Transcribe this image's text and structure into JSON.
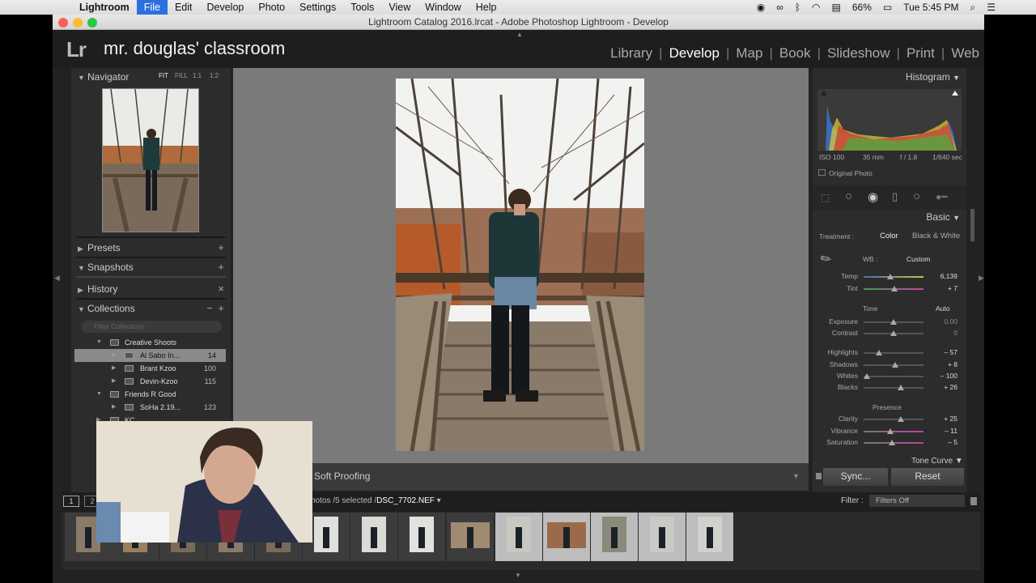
{
  "menubar": {
    "apple": "",
    "items": [
      "Lightroom",
      "File",
      "Edit",
      "Develop",
      "Photo",
      "Settings",
      "Tools",
      "View",
      "Window",
      "Help"
    ],
    "battery": "66%",
    "clock": "Tue 5:45 PM"
  },
  "window": {
    "title": "Lightroom Catalog 2016.lrcat - Adobe Photoshop Lightroom - Develop"
  },
  "app": {
    "logo": "Lr",
    "identity_plate": "mr. douglas' classroom",
    "modules": [
      "Library",
      "Develop",
      "Map",
      "Book",
      "Slideshow",
      "Print",
      "Web"
    ],
    "active_module": "Develop"
  },
  "navigator": {
    "title": "Navigator",
    "options": [
      "FIT",
      "FILL",
      "1:1",
      "1:2"
    ]
  },
  "left_panels": {
    "presets": "Presets",
    "snapshots": "Snapshots",
    "history": "History",
    "collections": "Collections",
    "filter_placeholder": "Filter Collections",
    "items": [
      {
        "label": "Creative Shoots",
        "count": ""
      },
      {
        "label": "Al Sabo In...",
        "count": "14"
      },
      {
        "label": "Brant Kzoo",
        "count": "100"
      },
      {
        "label": "Devin-Kzoo",
        "count": "115"
      },
      {
        "label": "Friends R Good",
        "count": ""
      },
      {
        "label": "SoHa 2.19...",
        "count": "123"
      },
      {
        "label": "KC",
        "count": ""
      }
    ]
  },
  "toolbar": {
    "soft_proofing": "Soft Proofing"
  },
  "histogram": {
    "title": "Histogram",
    "iso": "ISO 100",
    "focal": "35 mm",
    "aperture": "f / 1.8",
    "shutter": "1/640 sec",
    "original_photo": "Original Photo"
  },
  "basic": {
    "title": "Basic",
    "treatment_label": "Treatment :",
    "color": "Color",
    "bw": "Black & White",
    "wb_label": "WB :",
    "wb_value": "Custom",
    "tone_label": "Tone",
    "auto": "Auto",
    "presence_label": "Presence",
    "tone_curve": "Tone Curve",
    "sliders": [
      {
        "label": "Temp",
        "value": "6,139"
      },
      {
        "label": "Tint",
        "value": "+ 7"
      },
      {
        "label": "Exposure",
        "value": "0.00"
      },
      {
        "label": "Contrast",
        "value": "0"
      },
      {
        "label": "Highlights",
        "value": "– 57"
      },
      {
        "label": "Shadows",
        "value": "+ 8"
      },
      {
        "label": "Whites",
        "value": "– 100"
      },
      {
        "label": "Blacks",
        "value": "+ 26"
      },
      {
        "label": "Clarity",
        "value": "+ 25"
      },
      {
        "label": "Vibrance",
        "value": "– 11"
      },
      {
        "label": "Saturation",
        "value": "– 5"
      }
    ]
  },
  "buttons": {
    "sync": "Sync...",
    "reset": "Reset"
  },
  "filmstrip": {
    "pages": [
      "1",
      "2"
    ],
    "source_prefix": "hotos /5 selected /",
    "filename": "DSC_7702.NEF",
    "filter_label": "Filter :",
    "filter_value": "Filters Off"
  },
  "colors": {
    "accent": "#2d6fe0",
    "panel": "#2c2c2c",
    "center": "#7a7a7a"
  }
}
